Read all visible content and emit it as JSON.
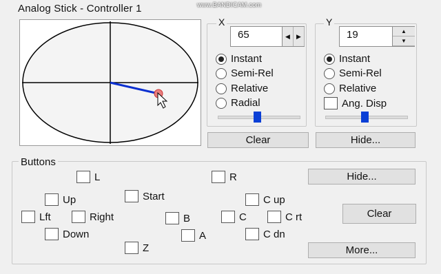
{
  "window": {
    "title": "Analog Stick - Controller 1",
    "watermark": "www.BANDICAM.com"
  },
  "x_axis": {
    "label": "X",
    "value": "65",
    "modes": [
      "Instant",
      "Semi-Rel",
      "Relative",
      "Radial"
    ],
    "selected_mode": "Instant",
    "slider_level": 0.5,
    "clear_label": "Clear"
  },
  "y_axis": {
    "label": "Y",
    "value": "19",
    "modes": [
      "Instant",
      "Semi-Rel",
      "Relative"
    ],
    "selected_mode": "Instant",
    "ang_disp_label": "Ang. Disp",
    "slider_level": 0.5,
    "hide_label": "Hide..."
  },
  "buttons_panel": {
    "title": "Buttons",
    "checkboxes": {
      "l": "L",
      "r": "R",
      "up": "Up",
      "start": "Start",
      "c_up": "C up",
      "lft": "Lft",
      "right": "Right",
      "b": "B",
      "c": "C",
      "c_rt": "C rt",
      "down": "Down",
      "a": "A",
      "c_dn": "C dn",
      "z": "Z"
    },
    "hide_label": "Hide...",
    "clear_label": "Clear",
    "more_label": "More..."
  },
  "colors": {
    "stick_line": "#0a2fd0",
    "slider_thumb": "#0a3fd6"
  }
}
